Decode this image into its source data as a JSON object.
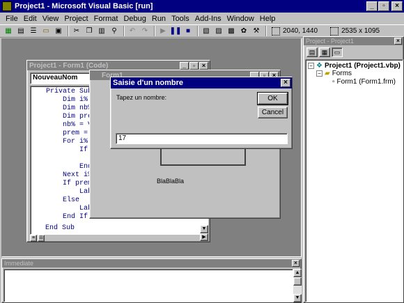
{
  "app": {
    "title": "Project1 - Microsoft Visual Basic [run]",
    "menu": [
      "File",
      "Edit",
      "View",
      "Project",
      "Format",
      "Debug",
      "Run",
      "Tools",
      "Add-Ins",
      "Window",
      "Help"
    ],
    "position_readout": "2040, 1440",
    "size_readout": "2535 x 1095"
  },
  "code_window": {
    "title": "Project1 - Form1 (Code)",
    "object_combo": "NouveauNom",
    "lines": [
      "Private Sub",
      "    Dim i%",
      "    Dim nb%",
      "    Dim pre",
      "    nb% = V",
      "    prem =",
      "    For i%",
      "        If",
      "",
      "        End",
      "    Next i%",
      "    If prem",
      "        Lab",
      "    Else",
      "        Lab",
      "    End If",
      "",
      "End Sub"
    ]
  },
  "form_window": {
    "title": "Form1",
    "label": "BlaBlaBla"
  },
  "dialog": {
    "title": "Saisie d'un nombre",
    "prompt": "Tapez un nombre:",
    "ok_label": "OK",
    "cancel_label": "Cancel",
    "input_value": "17"
  },
  "project_explorer": {
    "title": "Project - Project1",
    "project_label": "Project1 (Project1.vbp)",
    "forms_folder": "Forms",
    "form_item": "Form1 (Form1.frm)"
  },
  "immediate": {
    "title": "Immediate"
  },
  "colors": {
    "active_title": "#000080",
    "inactive_title": "#808080",
    "mdi_background": "#808080"
  }
}
